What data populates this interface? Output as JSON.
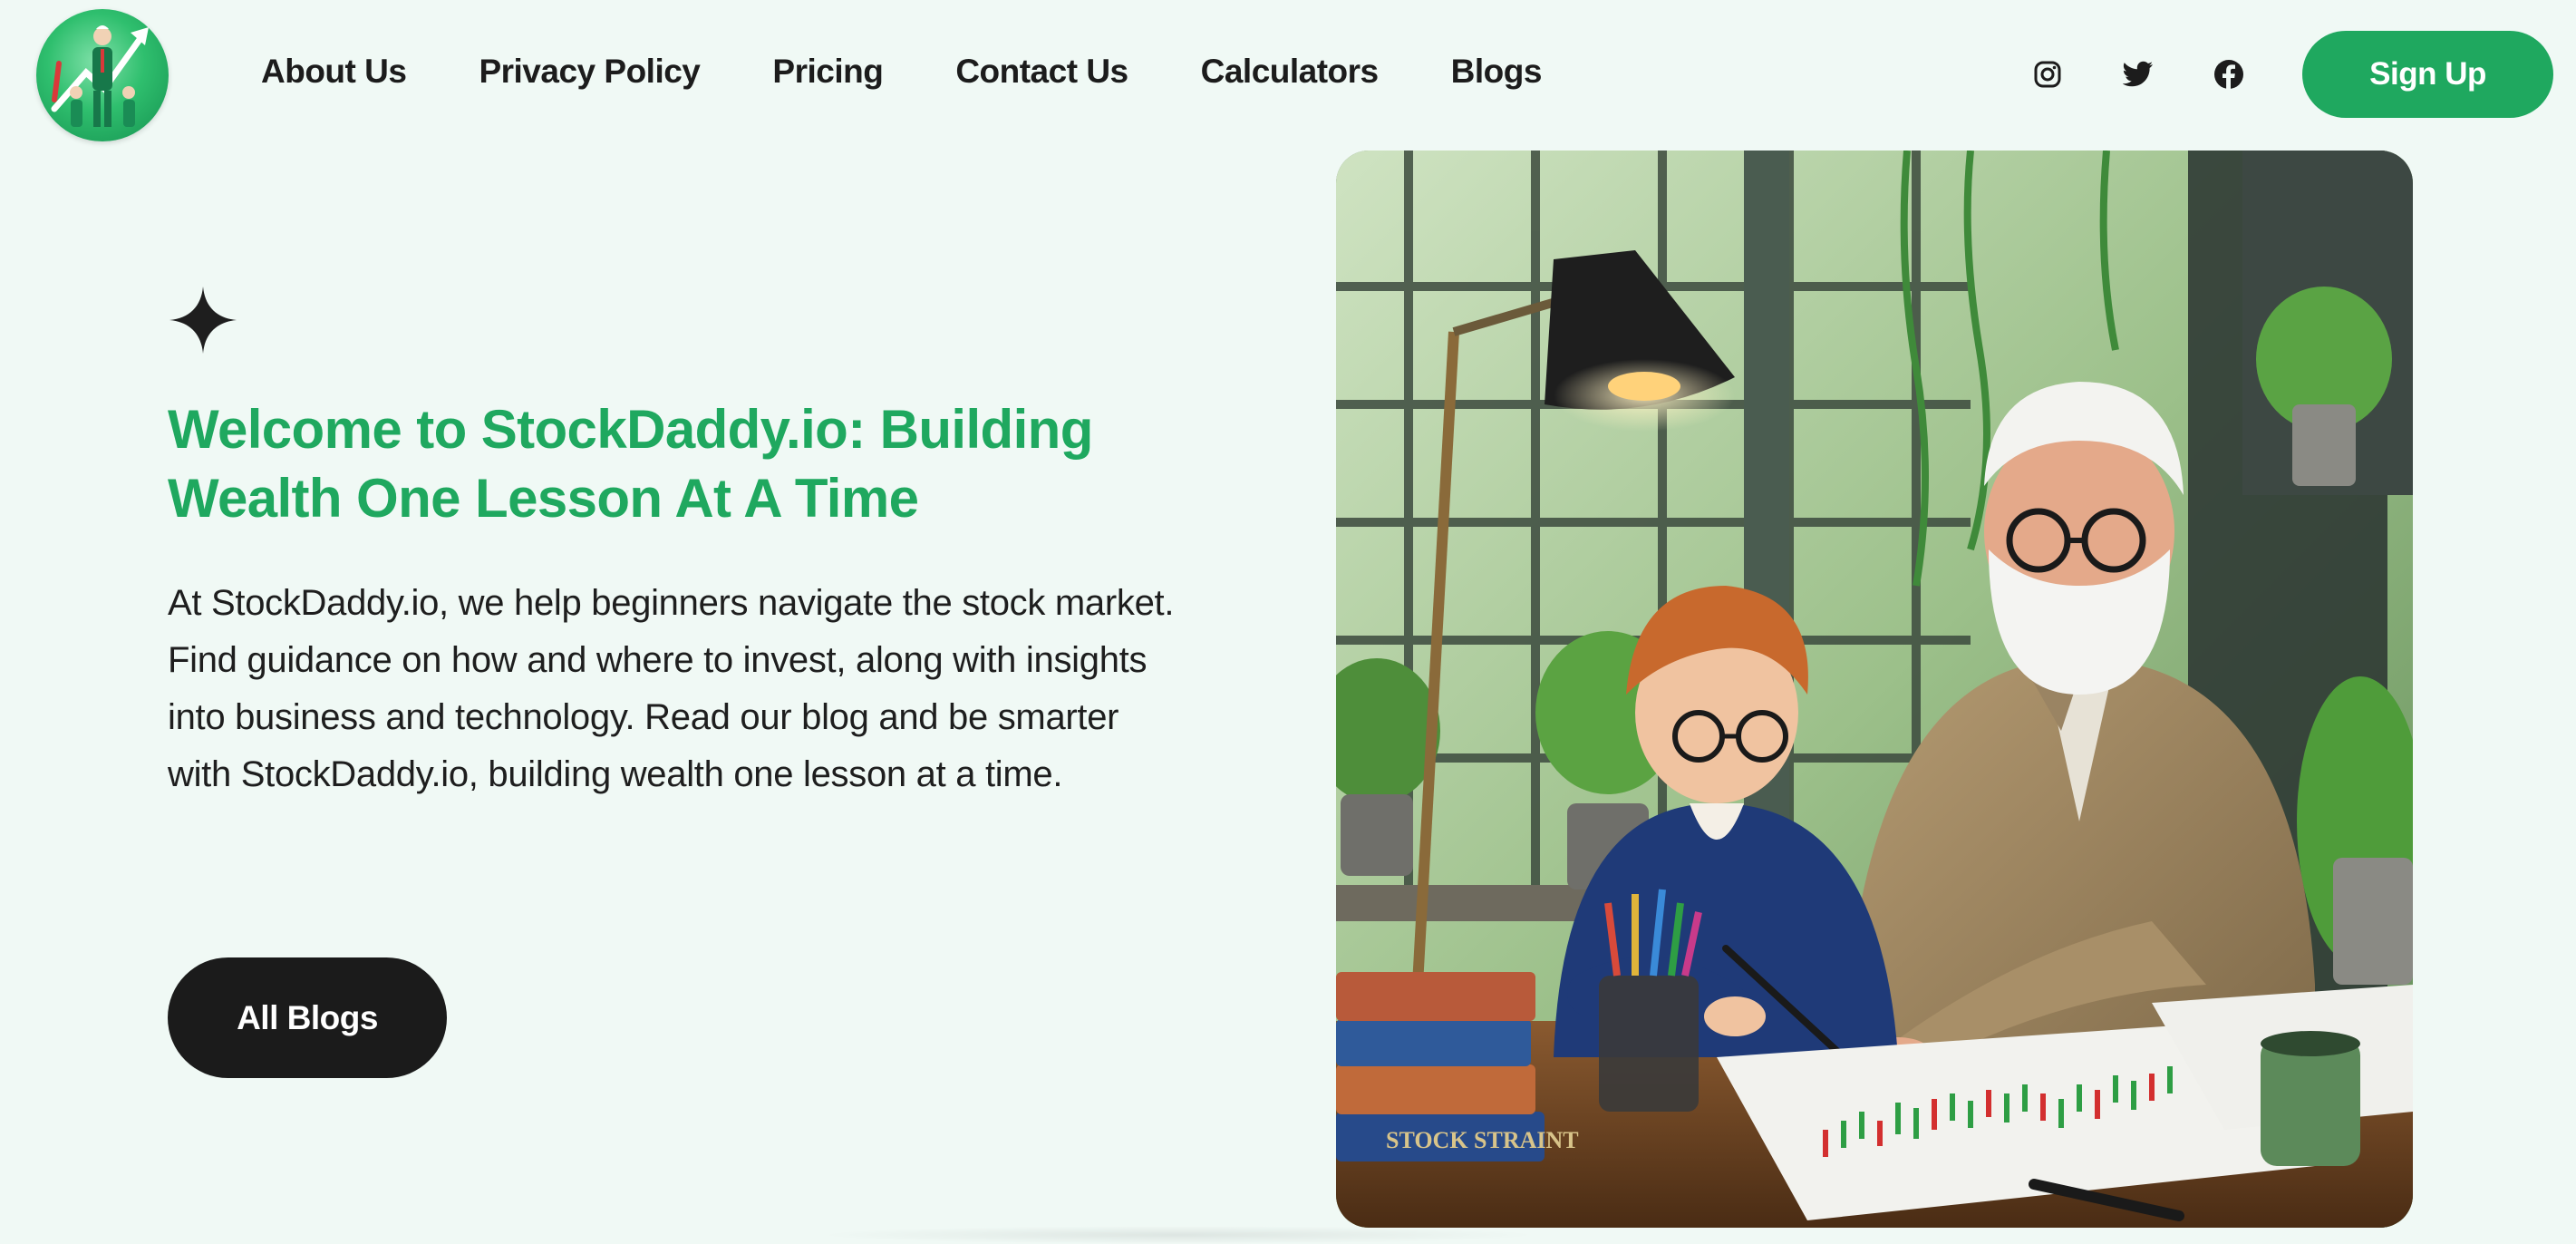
{
  "header": {
    "logo_icon": "stockdaddy-logo",
    "nav": [
      {
        "label": "About Us"
      },
      {
        "label": "Privacy Policy"
      },
      {
        "label": "Pricing"
      },
      {
        "label": "Contact Us"
      },
      {
        "label": "Calculators"
      },
      {
        "label": "Blogs"
      }
    ],
    "social": [
      "instagram-icon",
      "twitter-icon",
      "facebook-icon"
    ],
    "signup_label": "Sign Up"
  },
  "hero": {
    "title_line1": "Welcome to StockDaddy.io: Building",
    "title_line2": "Wealth One Lesson At A Time",
    "paragraph_lines": [
      "At StockDaddy.io, we help beginners navigate the stock market.",
      "Find guidance on how and where to invest, along with insights",
      "into business and technology. Read our blog and be smarter",
      "with StockDaddy.io, building wealth one lesson at a time."
    ],
    "cta_label": "All Blogs",
    "image_book_text": "STOCK STRAINT"
  },
  "colors": {
    "brand_green": "#1fa85f",
    "background": "#f0f9f5",
    "text_dark": "#1c1c1c",
    "button_dark": "#1b1b1b"
  }
}
